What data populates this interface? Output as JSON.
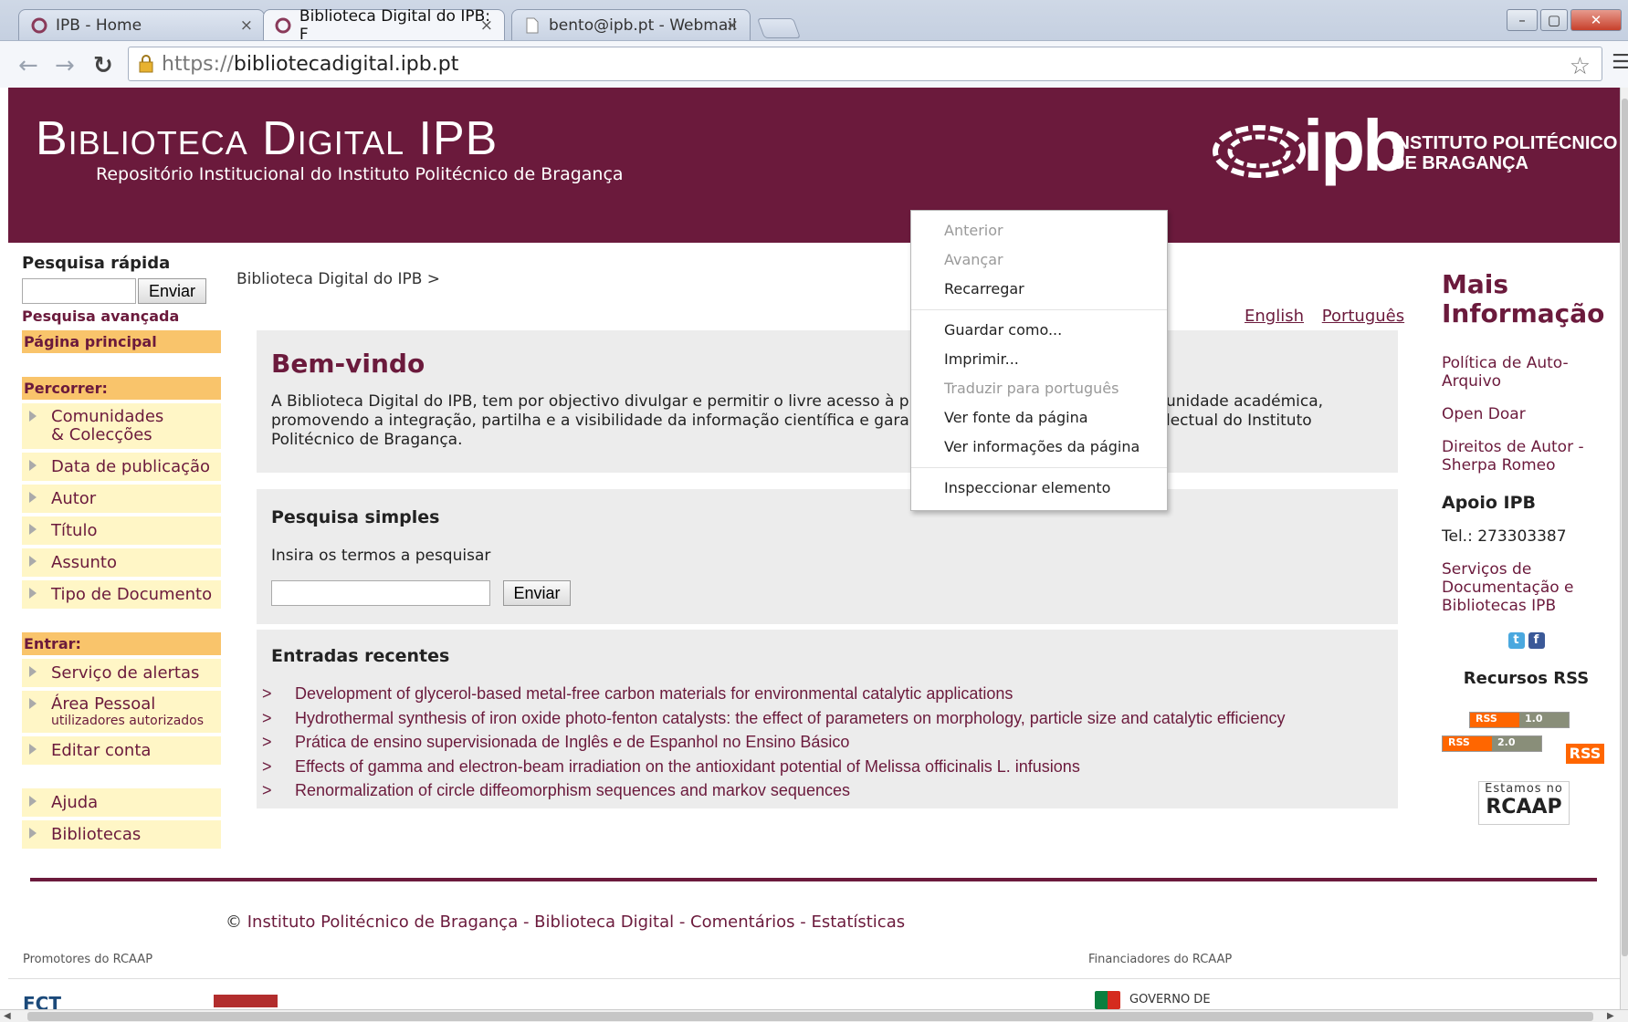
{
  "browser": {
    "tabs": [
      {
        "title": "IPB - Home",
        "close": "×"
      },
      {
        "title": "Biblioteca Digital do IPB: F",
        "close": "×"
      },
      {
        "title": "bento@ipb.pt - Webmail",
        "close": "×"
      }
    ],
    "url_scheme": "https://",
    "url_host": "bibliotecadigital.ipb.pt",
    "window_controls": {
      "minimize": "–",
      "maximize": "▢",
      "close": "✕"
    },
    "icons": {
      "back": "back-arrow-icon",
      "forward": "forward-arrow-icon",
      "reload": "reload-icon",
      "star": "bookmark-star-icon",
      "menu": "hamburger-menu-icon"
    }
  },
  "header": {
    "title": "Biblioteca Digital IPB",
    "subtitle": "Repositório Institucional do Instituto Politécnico de Bragança",
    "logo_word": "ipb",
    "institution_line1": "INSTITUTO POLITÉCNICO",
    "institution_line2": "DE BRAGANÇA",
    "brand_color": "#6b1a3c"
  },
  "sidebar": {
    "quick_search_title": "Pesquisa rápida",
    "quick_search_button": "Enviar",
    "advanced_search": "Pesquisa avançada",
    "home": "Página principal",
    "browse_title": "Percorrer:",
    "browse_items": [
      {
        "label": "Comunidades",
        "label2": "& Colecções"
      },
      {
        "label": "Data de publicação"
      },
      {
        "label": "Autor"
      },
      {
        "label": "Título"
      },
      {
        "label": "Assunto"
      },
      {
        "label": "Tipo de Documento"
      }
    ],
    "enter_title": "Entrar:",
    "enter_items": [
      {
        "label": "Serviço de alertas"
      },
      {
        "label": "Área Pessoal",
        "sub": "utilizadores autorizados"
      },
      {
        "label": "Editar conta"
      }
    ],
    "other_items": [
      {
        "label": "Ajuda"
      },
      {
        "label": "Bibliotecas"
      }
    ]
  },
  "main": {
    "breadcrumb": "Biblioteca Digital do IPB >",
    "lang_english": "English",
    "lang_portuguese": "Português",
    "welcome_title": "Bem-vindo",
    "welcome_text_left": "A Biblioteca Digital do IPB, tem por objectivo divulgar e permitir o livre acesso à prod",
    "welcome_text_right": "unidade académica,",
    "welcome_line2_left": "promovendo a integração, partilha e a visibilidade da informação científica e garantin",
    "welcome_line2_right": "lectual do Instituto",
    "welcome_line3": "Politécnico de Bragança.",
    "search_title": "Pesquisa simples",
    "search_label": "Insira os termos a pesquisar",
    "search_button": "Enviar",
    "recent_title": "Entradas recentes",
    "recent_items": [
      "Development of glycerol-based metal-free carbon materials for environmental catalytic applications",
      "Hydrothermal synthesis of iron oxide photo-fenton catalysts: the effect of parameters on morphology, particle size and catalytic efficiency",
      "Prática de ensino supervisionada de Inglês e de Espanhol no Ensino Básico",
      "Effects of gamma and electron-beam irradiation on the antioxidant potential of Melissa officinalis L. infusions",
      "Renormalization of circle diffeomorphism sequences and markov sequences"
    ]
  },
  "right": {
    "title_line1": "Mais",
    "title_line2": "Informação",
    "links": [
      {
        "line1": "Política de Auto-",
        "line2": "Arquivo"
      },
      {
        "line1": "Open Doar",
        "line2": ""
      },
      {
        "line1": "Direitos de Autor -",
        "line2": "Sherpa Romeo"
      }
    ],
    "support_title": "Apoio IPB",
    "phone": "Tel.: 273303387",
    "services_line1": "Serviços de",
    "services_line2": "Documentação e",
    "services_line3": "Bibliotecas IPB",
    "rss_title": "Recursos RSS",
    "rss_badge_left": "RSS",
    "rss_v1": "1.0",
    "rss_v2": "2.0",
    "rss_big": "RSS",
    "rcaap_small": "Estamos no",
    "rcaap_big": "RCAAP"
  },
  "footer": {
    "copyright": "©",
    "links": "Instituto Politécnico de Bragança - Biblioteca Digital - Comentários - Estatísticas",
    "promotores": "Promotores do RCAAP",
    "financiadores": "Financiadores do RCAAP",
    "fct": "FCT",
    "gov": "GOVERNO DE"
  },
  "context_menu": {
    "items": [
      {
        "label": "Anterior",
        "disabled": true
      },
      {
        "label": "Avançar",
        "disabled": true
      },
      {
        "label": "Recarregar",
        "disabled": false
      },
      {
        "label": "Guardar como...",
        "disabled": false
      },
      {
        "label": "Imprimir...",
        "disabled": false
      },
      {
        "label": "Traduzir para português",
        "disabled": true
      },
      {
        "label": "Ver fonte da página",
        "disabled": false
      },
      {
        "label": "Ver informações da página",
        "disabled": false
      },
      {
        "label": "Inspeccionar elemento",
        "disabled": false
      }
    ]
  }
}
